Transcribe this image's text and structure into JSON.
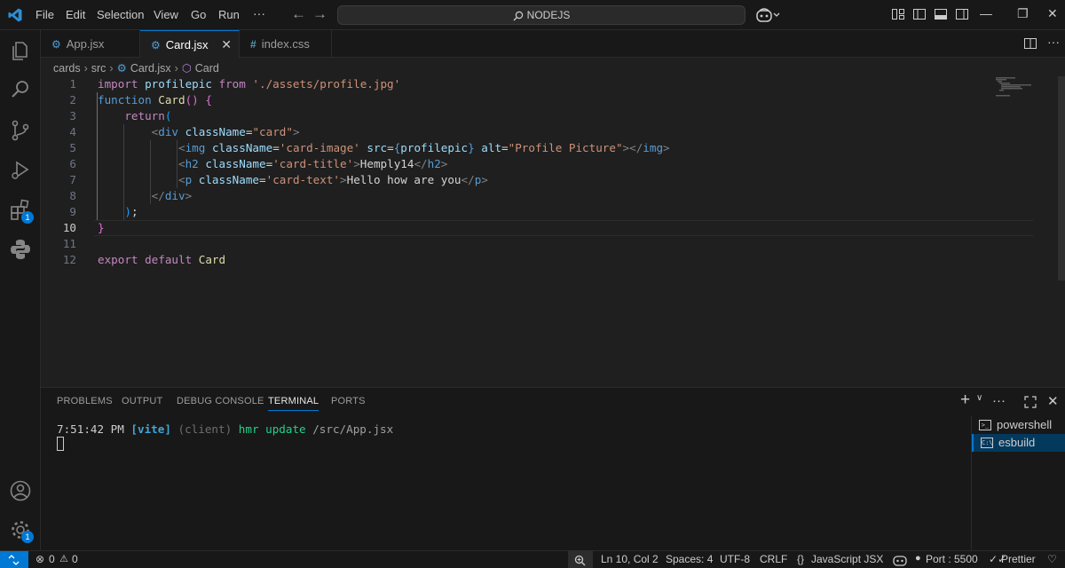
{
  "menu": {
    "items": [
      "File",
      "Edit",
      "Selection",
      "View",
      "Go",
      "Run"
    ],
    "more": "···"
  },
  "search": {
    "text": "NODEJS"
  },
  "tabs": [
    {
      "label": "App.jsx",
      "active": false
    },
    {
      "label": "Card.jsx",
      "active": true
    },
    {
      "label": "index.css",
      "active": false
    }
  ],
  "breadcrumb": [
    "cards",
    "src",
    "Card.jsx",
    "Card"
  ],
  "editor": {
    "active_line": 10,
    "lines": [
      [
        [
          "kw",
          "import "
        ],
        [
          "var",
          "profilepic "
        ],
        [
          "kw",
          "from "
        ],
        [
          "str",
          "'./assets/profile.jpg'"
        ]
      ],
      [
        [
          "kwb",
          "function "
        ],
        [
          "fn",
          "Card"
        ],
        [
          "brace",
          "()"
        ],
        [
          "txt",
          " "
        ],
        [
          "brace",
          "{"
        ]
      ],
      [
        [
          "txt",
          "    "
        ],
        [
          "kw",
          "return"
        ],
        [
          "brace2",
          "("
        ]
      ],
      [
        [
          "txt",
          "        "
        ],
        [
          "punc",
          "<"
        ],
        [
          "tag",
          "div "
        ],
        [
          "attr",
          "className"
        ],
        [
          "txt",
          "="
        ],
        [
          "str",
          "\"card\""
        ],
        [
          "punc",
          ">"
        ]
      ],
      [
        [
          "txt",
          "            "
        ],
        [
          "punc",
          "<"
        ],
        [
          "tag",
          "img "
        ],
        [
          "attr",
          "className"
        ],
        [
          "txt",
          "="
        ],
        [
          "str",
          "'card-image' "
        ],
        [
          "attr",
          "src"
        ],
        [
          "txt",
          "="
        ],
        [
          "kwb",
          "{"
        ],
        [
          "var",
          "profilepic"
        ],
        [
          "kwb",
          "} "
        ],
        [
          "attr",
          "alt"
        ],
        [
          "txt",
          "="
        ],
        [
          "str",
          "\"Profile Picture\""
        ],
        [
          "punc",
          "></"
        ],
        [
          "tag",
          "img"
        ],
        [
          "punc",
          ">"
        ]
      ],
      [
        [
          "txt",
          "            "
        ],
        [
          "punc",
          "<"
        ],
        [
          "tag",
          "h2 "
        ],
        [
          "attr",
          "className"
        ],
        [
          "txt",
          "="
        ],
        [
          "str",
          "'card-title'"
        ],
        [
          "punc",
          ">"
        ],
        [
          "txt",
          "Hemply14"
        ],
        [
          "punc",
          "</"
        ],
        [
          "tag",
          "h2"
        ],
        [
          "punc",
          ">"
        ]
      ],
      [
        [
          "txt",
          "            "
        ],
        [
          "punc",
          "<"
        ],
        [
          "tag",
          "p "
        ],
        [
          "attr",
          "className"
        ],
        [
          "txt",
          "="
        ],
        [
          "str",
          "'card-text'"
        ],
        [
          "punc",
          ">"
        ],
        [
          "txt",
          "Hello how are you"
        ],
        [
          "punc",
          "</"
        ],
        [
          "tag",
          "p"
        ],
        [
          "punc",
          ">"
        ]
      ],
      [
        [
          "txt",
          "        "
        ],
        [
          "punc",
          "</"
        ],
        [
          "tag",
          "div"
        ],
        [
          "punc",
          ">"
        ]
      ],
      [
        [
          "txt",
          "    "
        ],
        [
          "brace2",
          ")"
        ],
        [
          "txt",
          ";"
        ]
      ],
      [
        [
          "brace",
          "}"
        ]
      ],
      [],
      [
        [
          "kw",
          "export "
        ],
        [
          "kw",
          "default "
        ],
        [
          "fn",
          "Card"
        ]
      ]
    ]
  },
  "panel": {
    "tabs": [
      "PROBLEMS",
      "OUTPUT",
      "DEBUG CONSOLE",
      "TERMINAL",
      "PORTS"
    ],
    "active_tab": "TERMINAL",
    "terminal": {
      "time": "7:51:42 PM",
      "tag": "[vite]",
      "client": "(client)",
      "msg": "hmr update",
      "path": "/src/App.jsx"
    },
    "terminals": [
      {
        "label": "powershell",
        "active": false
      },
      {
        "label": "esbuild",
        "active": true
      }
    ]
  },
  "badges": {
    "extensions": "1",
    "settings": "1"
  },
  "status": {
    "errors": "0",
    "warnings": "0",
    "position": "Ln 10, Col 2",
    "spaces": "Spaces: 4",
    "encoding": "UTF-8",
    "eol": "CRLF",
    "language": "JavaScript JSX",
    "port": "Port : 5500",
    "formatter": "Prettier"
  },
  "colors": {
    "accent": "#0078d4",
    "background": "#1f1f1f",
    "chrome": "#181818"
  }
}
